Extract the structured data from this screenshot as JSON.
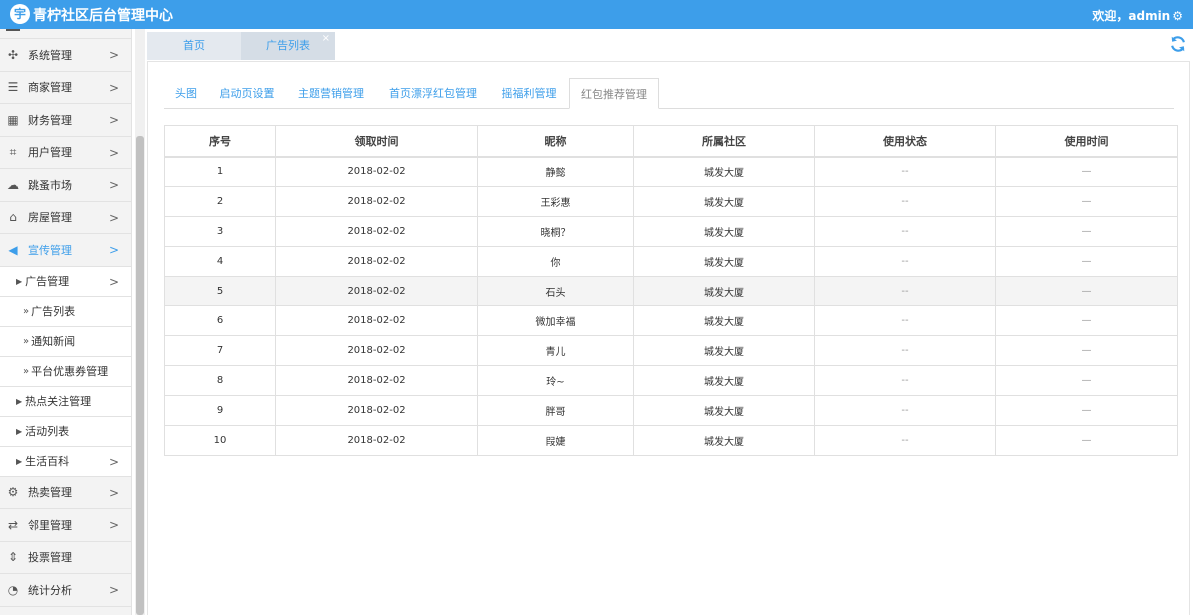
{
  "header": {
    "logo_glyph": "宇",
    "title": "青柠社区后台管理中心",
    "welcome": "欢迎，admin",
    "settings_icon": "gear-icon"
  },
  "sidebar": {
    "items": [
      {
        "label": "系统管理",
        "icon": "settings-cluster-icon",
        "glyph": "✣"
      },
      {
        "label": "商家管理",
        "icon": "list-icon",
        "glyph": "☰"
      },
      {
        "label": "财务管理",
        "icon": "calculator-icon",
        "glyph": "▦"
      },
      {
        "label": "用户管理",
        "icon": "crop-icon",
        "glyph": "⌗"
      },
      {
        "label": "跳蚤市场",
        "icon": "cloud-icon",
        "glyph": "☁"
      },
      {
        "label": "房屋管理",
        "icon": "bank-icon",
        "glyph": "⌂"
      },
      {
        "label": "宣传管理",
        "icon": "megaphone-icon",
        "glyph": "◀"
      }
    ],
    "sub_ad": "广告管理",
    "sub_ad_children": [
      "广告列表",
      "通知新闻",
      "平台优惠券管理"
    ],
    "sub_hot": "热点关注管理",
    "sub_activity": "活动列表",
    "sub_life": "生活百科",
    "items_bottom": [
      {
        "label": "热卖管理",
        "icon": "gear-outline-icon",
        "glyph": "⚙"
      },
      {
        "label": "邻里管理",
        "icon": "retweet-icon",
        "glyph": "⇄"
      },
      {
        "label": "投票管理",
        "icon": "sort-icon",
        "glyph": "⇕"
      },
      {
        "label": "统计分析",
        "icon": "pie-chart-icon",
        "glyph": "◔"
      }
    ]
  },
  "page_tabs": {
    "home": "首页",
    "current": "广告列表",
    "close": "×"
  },
  "sub_tabs": [
    "头图",
    "启动页设置",
    "主题营销管理",
    "首页漂浮红包管理",
    "摇福利管理",
    "红包推荐管理"
  ],
  "table": {
    "headers": [
      "序号",
      "领取时间",
      "昵称",
      "所属社区",
      "使用状态",
      "使用时间"
    ],
    "rows": [
      [
        "1",
        "2018-02-02",
        "静懿",
        "城发大厦",
        "--",
        "—"
      ],
      [
        "2",
        "2018-02-02",
        "王彩惠",
        "城发大厦",
        "--",
        "—"
      ],
      [
        "3",
        "2018-02-02",
        "晓桐？",
        "城发大厦",
        "--",
        "—"
      ],
      [
        "4",
        "2018-02-02",
        "你",
        "城发大厦",
        "--",
        "—"
      ],
      [
        "5",
        "2018-02-02",
        "石头",
        "城发大厦",
        "--",
        "—"
      ],
      [
        "6",
        "2018-02-02",
        "微加幸福",
        "城发大厦",
        "--",
        "—"
      ],
      [
        "7",
        "2018-02-02",
        "青儿",
        "城发大厦",
        "--",
        "—"
      ],
      [
        "8",
        "2018-02-02",
        "玲~",
        "城发大厦",
        "--",
        "—"
      ],
      [
        "9",
        "2018-02-02",
        "胖哥",
        "城发大厦",
        "--",
        "—"
      ],
      [
        "10",
        "2018-02-02",
        "叚婕",
        "城发大厦",
        "--",
        "—"
      ]
    ]
  },
  "colors": {
    "accent": "#3d9eea",
    "sidebar_bg": "#f3f3f3",
    "highlight_row": "#f4f4f4"
  }
}
